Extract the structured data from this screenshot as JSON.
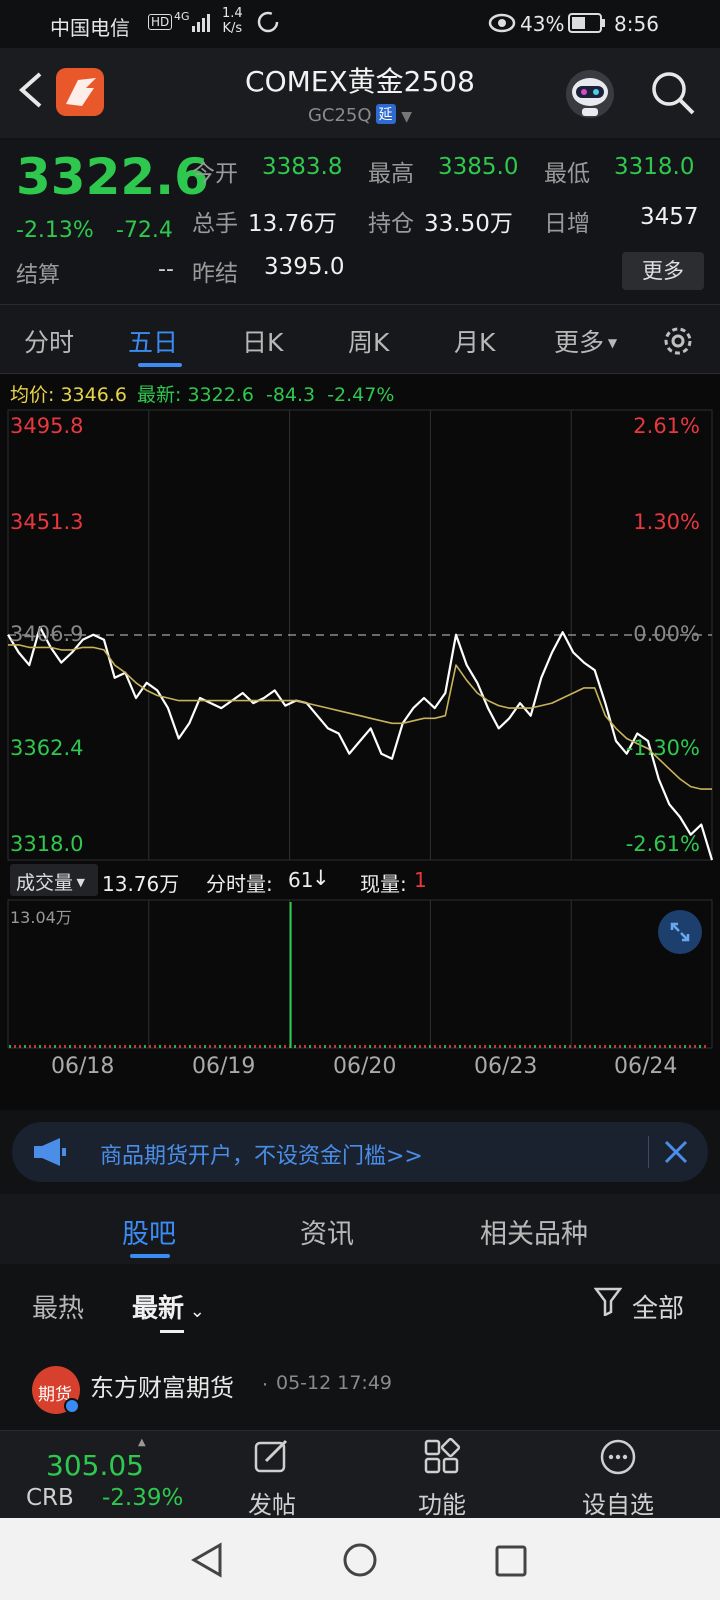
{
  "status_bar": {
    "carrier": "中国电信",
    "hd": "HD",
    "network": "4G",
    "speed_value": "1.4",
    "speed_unit": "K/s",
    "battery": "43%",
    "time": "8:56"
  },
  "header": {
    "title": "COMEX黄金2508",
    "code": "GC25Q",
    "delay_badge": "延"
  },
  "quote": {
    "last_price": "3322.6",
    "change_pct": "-2.13%",
    "change": "-72.4",
    "settle_label": "结算",
    "settle_value": "--",
    "fields": [
      {
        "label": "今开",
        "value": "3383.8",
        "tone": "green"
      },
      {
        "label": "最高",
        "value": "3385.0",
        "tone": "green"
      },
      {
        "label": "最低",
        "value": "3318.0",
        "tone": "green"
      },
      {
        "label": "总手",
        "value": "13.76万",
        "tone": "white"
      },
      {
        "label": "持仓",
        "value": "33.50万",
        "tone": "white"
      },
      {
        "label": "日增",
        "value": "3457",
        "tone": "white"
      },
      {
        "label": "昨结",
        "value": "3395.0",
        "tone": "white"
      }
    ],
    "more_button": "更多"
  },
  "tabs": [
    "分时",
    "五日",
    "日K",
    "周K",
    "月K",
    "更多"
  ],
  "active_tab": "五日",
  "chart_info": {
    "avg_label": "均价:",
    "avg_value": "3346.6",
    "latest_label": "最新:",
    "latest_value": "3322.6",
    "latest_change": "-84.3",
    "latest_pct": "-2.47%"
  },
  "chart_data": {
    "type": "line",
    "x": [
      "06/18",
      "06/19",
      "06/20",
      "06/23",
      "06/24"
    ],
    "ylim": [
      3318.0,
      3495.8
    ],
    "y_ticks_left": [
      "3495.8",
      "3451.3",
      "3406.9",
      "3362.4",
      "3318.0"
    ],
    "y_ticks_right": [
      "2.61%",
      "1.30%",
      "0.00%",
      "-1.30%",
      "-2.61%"
    ],
    "reference_price": 3406.9,
    "series": [
      {
        "name": "price",
        "color": "#ffffff",
        "values": [
          3407,
          3400,
          3395,
          3410,
          3402,
          3396,
          3400,
          3405,
          3407,
          3405,
          3390,
          3392,
          3382,
          3388,
          3385,
          3378,
          3366,
          3372,
          3382,
          3380,
          3378,
          3381,
          3384,
          3380,
          3382,
          3385,
          3379,
          3381,
          3380,
          3375,
          3370,
          3368,
          3360,
          3365,
          3370,
          3360,
          3358,
          3372,
          3378,
          3382,
          3378,
          3384,
          3407,
          3395,
          3388,
          3378,
          3370,
          3374,
          3380,
          3375,
          3390,
          3400,
          3408,
          3400,
          3396,
          3393,
          3380,
          3365,
          3360,
          3368,
          3365,
          3350,
          3340,
          3335,
          3328,
          3332,
          3318
        ]
      },
      {
        "name": "avg",
        "color": "#c9b25a",
        "values": [
          3403,
          3403,
          3402,
          3402,
          3402,
          3401,
          3401,
          3402,
          3402,
          3401,
          3395,
          3392,
          3388,
          3385,
          3383,
          3382,
          3381,
          3381,
          3381,
          3381,
          3381,
          3381,
          3381,
          3381,
          3381,
          3381,
          3381,
          3381,
          3380,
          3379,
          3378,
          3377,
          3376,
          3375,
          3374,
          3373,
          3372,
          3372,
          3373,
          3374,
          3374,
          3375,
          3395,
          3389,
          3384,
          3381,
          3379,
          3378,
          3378,
          3378,
          3379,
          3380,
          3382,
          3384,
          3386,
          3386,
          3375,
          3370,
          3366,
          3364,
          3362,
          3358,
          3354,
          3350,
          3347,
          3346,
          3346
        ]
      }
    ]
  },
  "volume": {
    "selector_label": "成交量",
    "total": "13.76万",
    "interval_label": "分时量:",
    "interval_value": "61",
    "interval_arrow": "↓",
    "current_label": "现量:",
    "current_value": "1",
    "axis_max": "13.04万"
  },
  "ad": {
    "text": "商品期货开户，不设资金门槛>>"
  },
  "community_tabs": [
    "股吧",
    "资讯",
    "相关品种"
  ],
  "community_active": "股吧",
  "filters": {
    "hot": "最热",
    "latest": "最新",
    "all": "全部"
  },
  "post": {
    "avatar_text": "期货",
    "author": "东方财富期货",
    "time": "05-12 17:49"
  },
  "bottom_bar": {
    "index_value": "305.05",
    "index_name": "CRB",
    "index_pct": "-2.39%",
    "post": "发帖",
    "functions": "功能",
    "watchlist": "设自选"
  },
  "colors": {
    "up": "#e8383d",
    "down": "#2ec84e",
    "accent": "#3b8bf5",
    "avg_line": "#c9b25a"
  }
}
